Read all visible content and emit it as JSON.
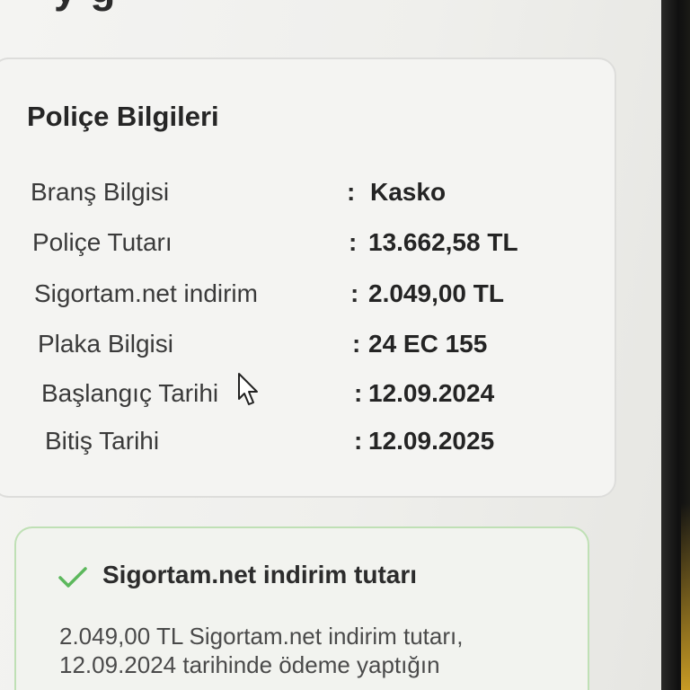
{
  "page_heading_partial": "y g",
  "policy_card": {
    "title": "Poliçe Bilgileri",
    "rows": [
      {
        "label": "Branş Bilgisi",
        "colon": ":",
        "value": "Kasko"
      },
      {
        "label": "Poliçe Tutarı",
        "colon": ":",
        "value": "13.662,58 TL"
      },
      {
        "label": "Sigortam.net indirim",
        "colon": ":",
        "value": "2.049,00 TL"
      },
      {
        "label": "Plaka Bilgisi",
        "colon": ":",
        "value": "24 EC 155"
      },
      {
        "label": "Başlangıç Tarihi",
        "colon": ":",
        "value": "12.09.2024"
      },
      {
        "label": "Bitiş Tarihi",
        "colon": ":",
        "value": "12.09.2025"
      }
    ]
  },
  "discount_card": {
    "icon": "check-icon",
    "title": "Sigortam.net indirim tutarı",
    "text_lines": [
      "2.049,00 TL Sigortam.net indirim tutarı,",
      "12.09.2024 tarihinde ödeme yaptığın"
    ],
    "accent_color": "#5cb85c"
  }
}
